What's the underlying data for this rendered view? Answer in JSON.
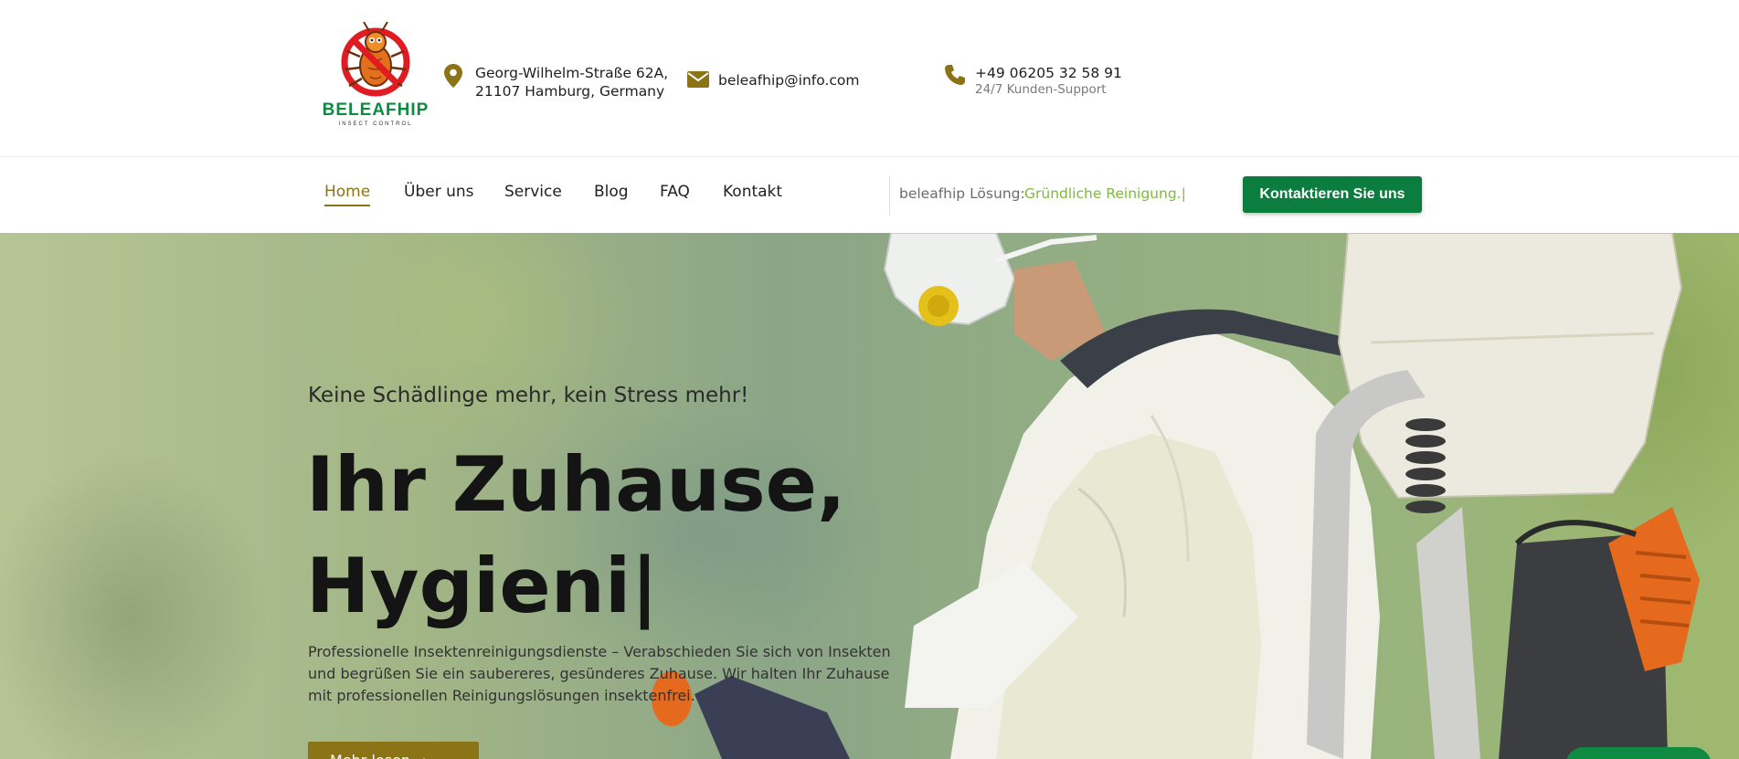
{
  "brand": {
    "name": "BELEAFHIP",
    "tagline": "INSECT CONTROL"
  },
  "contacts": {
    "address_line1": "Georg-Wilhelm-Straße 62A,",
    "address_line2": "21107 Hamburg, Germany",
    "email": "beleafhip@info.com",
    "phone": "+49 06205 32 58 91",
    "phone_note": "24/7 Kunden-Support"
  },
  "nav": {
    "items": [
      {
        "label": "Home",
        "active": true
      },
      {
        "label": "Über uns",
        "active": false
      },
      {
        "label": "Service",
        "active": false
      },
      {
        "label": "Blog",
        "active": false
      },
      {
        "label": "FAQ",
        "active": false
      },
      {
        "label": "Kontakt",
        "active": false
      }
    ],
    "solution_label": "beleafhip Lösung:",
    "solution_value": "Gründliche Reinigung.|",
    "cta_label": "Kontaktieren Sie uns"
  },
  "hero": {
    "subtitle": "Keine Schädlinge mehr, kein Stress mehr!",
    "title_line1": "Ihr Zuhause,",
    "title_line2": "Hygieni|",
    "description": "Professionelle Insektenreinigungsdienste – Verabschieden Sie sich von Insekten und begrüßen Sie ein saubereres, gesünderes Zuhause. Wir halten Ihr Zuhause mit professionellen Reinigungslösungen insektenfrei.",
    "button_label": "Mehr lesen"
  },
  "colors": {
    "brand_green": "#0b7d3e",
    "accent_gold": "#8a7416",
    "solution_green": "#7dbb3a"
  }
}
